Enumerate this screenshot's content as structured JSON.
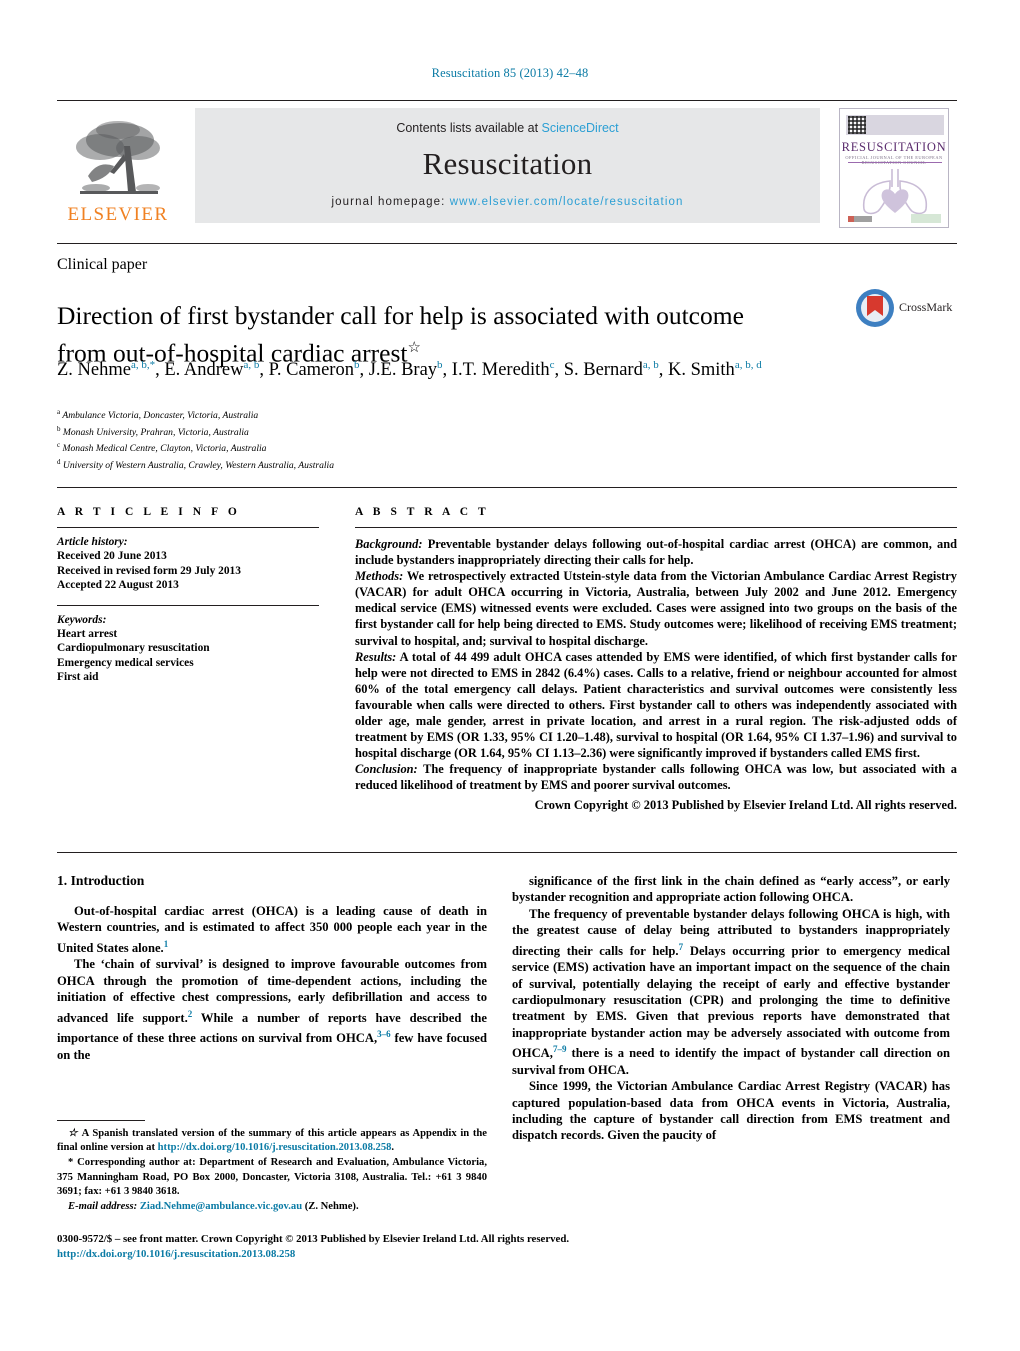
{
  "running_head": "Resuscitation 85 (2013) 42–48",
  "masthead": {
    "contents_prefix": "Contents lists available at",
    "contents_link": "ScienceDirect",
    "journal_title": "Resuscitation",
    "homepage_prefix": "journal homepage:",
    "homepage_url": "www.elsevier.com/locate/resuscitation",
    "publisher_logo_text": "ELSEVIER",
    "cover": {
      "title": "RESUSCITATION",
      "subtitle": "OFFICIAL JOURNAL OF THE EUROPEAN RESUSCITATION COUNCIL"
    }
  },
  "article": {
    "kicker": "Clinical paper",
    "title": "Direction of first bystander call for help is associated with outcome from out-of-hospital cardiac arrest",
    "title_marker": "☆",
    "crossmark_label": "CrossMark",
    "authors_html": "Z. Nehme<sup>a, b,</sup><sup>*</sup>, E. Andrew<sup>a, b</sup>, P. Cameron<sup>b</sup>, J.E. Bray<sup>b</sup>, I.T. Meredith<sup>c</sup>, S. Bernard<sup>a, b</sup>, K. Smith<sup>a, b, d</sup>",
    "affiliations": [
      {
        "mark": "a",
        "text": "Ambulance Victoria, Doncaster, Victoria, Australia"
      },
      {
        "mark": "b",
        "text": "Monash University, Prahran, Victoria, Australia"
      },
      {
        "mark": "c",
        "text": "Monash Medical Centre, Clayton, Victoria, Australia"
      },
      {
        "mark": "d",
        "text": "University of Western Australia, Crawley, Western Australia, Australia"
      }
    ]
  },
  "article_info": {
    "heading": "A R T I C L E    I N F O",
    "history_label": "Article history:",
    "history": [
      "Received 20 June 2013",
      "Received in revised form 29 July 2013",
      "Accepted 22 August 2013"
    ],
    "keywords_label": "Keywords:",
    "keywords": [
      "Heart arrest",
      "Cardiopulmonary resuscitation",
      "Emergency medical services",
      "First aid"
    ]
  },
  "abstract": {
    "heading": "A B S T R A C T",
    "sections": [
      {
        "label": "Background:",
        "text": " Preventable bystander delays following out-of-hospital cardiac arrest (OHCA) are common, and include bystanders inappropriately directing their calls for help."
      },
      {
        "label": "Methods:",
        "text": " We retrospectively extracted Utstein-style data from the Victorian Ambulance Cardiac Arrest Registry (VACAR) for adult OHCA occurring in Victoria, Australia, between July 2002 and June 2012. Emergency medical service (EMS) witnessed events were excluded. Cases were assigned into two groups on the basis of the first bystander call for help being directed to EMS. Study outcomes were; likelihood of receiving EMS treatment; survival to hospital, and; survival to hospital discharge."
      },
      {
        "label": "Results:",
        "text": " A total of 44 499 adult OHCA cases attended by EMS were identified, of which first bystander calls for help were not directed to EMS in 2842 (6.4%) cases. Calls to a relative, friend or neighbour accounted for almost 60% of the total emergency call delays. Patient characteristics and survival outcomes were consistently less favourable when calls were directed to others. First bystander call to others was independently associated with older age, male gender, arrest in private location, and arrest in a rural region. The risk-adjusted odds of treatment by EMS (OR 1.33, 95% CI 1.20–1.48), survival to hospital (OR 1.64, 95% CI 1.37–1.96) and survival to hospital discharge (OR 1.64, 95% CI 1.13–2.36) were significantly improved if bystanders called EMS first."
      },
      {
        "label": "Conclusion:",
        "text": " The frequency of inappropriate bystander calls following OHCA was low, but associated with a reduced likelihood of treatment by EMS and poorer survival outcomes."
      }
    ],
    "copyright": "Crown Copyright © 2013 Published by Elsevier Ireland Ltd. All rights reserved."
  },
  "body": {
    "section_heading": "1. Introduction",
    "left_paragraphs": [
      "Out-of-hospital cardiac arrest (OHCA) is a leading cause of death in Western countries, and is estimated to affect 350 000 people each year in the United States alone.<sup>1</sup>",
      "The ‘chain of survival’ is designed to improve favourable outcomes from OHCA through the promotion of time-dependent actions, including the initiation of effective chest compressions, early defibrillation and access to advanced life support.<sup>2</sup> While a number of reports have described the importance of these three actions on survival from OHCA,<sup>3–6</sup> few have focused on the"
    ],
    "right_paragraphs": [
      "significance of the first link in the chain defined as “early access”, or early bystander recognition and appropriate action following OHCA.",
      "The frequency of preventable bystander delays following OHCA is high, with the greatest cause of delay being attributed to bystanders inappropriately directing their calls for help.<sup>7</sup> Delays occurring prior to emergency medical service (EMS) activation have an important impact on the sequence of the chain of survival, potentially delaying the receipt of early and effective bystander cardiopulmonary resuscitation (CPR) and prolonging the time to definitive treatment by EMS. Given that previous reports have demonstrated that inappropriate bystander action may be adversely associated with outcome from OHCA,<sup>7–9</sup> there is a need to identify the impact of bystander call direction on survival from OHCA.",
      "Since 1999, the Victorian Ambulance Cardiac Arrest Registry (VACAR) has captured population-based data from OHCA events in Victoria, Australia, including the capture of bystander call direction from EMS treatment and dispatch records. Given the paucity of"
    ]
  },
  "footnotes": {
    "star_note_html": "<span class=\"it\">☆</span> A Spanish translated version of the summary of this article appears as Appendix in the final online version at <span class=\"lnk\">http://dx.doi.org/10.1016/j.resuscitation.2013.08.258</span>.",
    "corresponding_html": "* Corresponding author at: Department of Research and Evaluation, Ambulance Victoria, 375 Manningham Road, PO Box 2000, Doncaster, Victoria 3108, Australia. Tel.: +61 3 9840 3691; fax: +61 3 9840 3618.",
    "email_html": "<span class=\"it\">E-mail address:</span> <span class=\"lnk\">Ziad.Nehme@ambulance.vic.gov.au</span> (Z. Nehme)."
  },
  "colophon": {
    "line1": "0300-9572/$ – see front matter. Crown Copyright © 2013 Published by Elsevier Ireland Ltd. All rights reserved.",
    "doi": "http://dx.doi.org/10.1016/j.resuscitation.2013.08.258"
  },
  "colors": {
    "link": "#0b7ba5",
    "sciencedirect": "#2b9fd4",
    "elsevier_orange": "#f08122",
    "band_gray": "#e6e7e8",
    "cover_purple": "#5b2d6e"
  }
}
